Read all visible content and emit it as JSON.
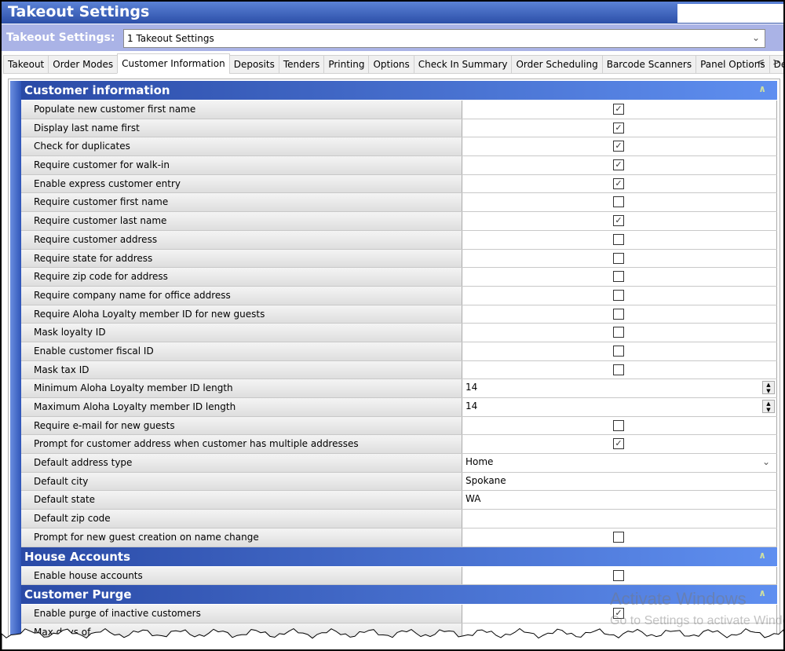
{
  "window": {
    "title": "Takeout Settings"
  },
  "selector": {
    "label": "Takeout Settings:",
    "value": "1 Takeout Settings"
  },
  "tabs": [
    "Takeout",
    "Order Modes",
    "Customer Information",
    "Deposits",
    "Tenders",
    "Printing",
    "Options",
    "Check In Summary",
    "Order Scheduling",
    "Barcode Scanners",
    "Panel Options",
    "Deliv"
  ],
  "active_tab": "Customer Information",
  "sections": [
    {
      "title": "Customer information",
      "rows": [
        {
          "label": "Populate new customer first name",
          "type": "checkbox",
          "checked": true
        },
        {
          "label": "Display last name first",
          "type": "checkbox",
          "checked": true
        },
        {
          "label": "Check for duplicates",
          "type": "checkbox",
          "checked": true
        },
        {
          "label": "Require customer for walk-in",
          "type": "checkbox",
          "checked": true
        },
        {
          "label": "Enable express customer entry",
          "type": "checkbox",
          "checked": true
        },
        {
          "label": "Require customer first name",
          "type": "checkbox",
          "checked": false
        },
        {
          "label": "Require customer last name",
          "type": "checkbox",
          "checked": true
        },
        {
          "label": "Require customer address",
          "type": "checkbox",
          "checked": false
        },
        {
          "label": "Require state for address",
          "type": "checkbox",
          "checked": false
        },
        {
          "label": "Require zip code for address",
          "type": "checkbox",
          "checked": false
        },
        {
          "label": "Require company name for office address",
          "type": "checkbox",
          "checked": false
        },
        {
          "label": "Require Aloha Loyalty member ID for new guests",
          "type": "checkbox",
          "checked": false
        },
        {
          "label": "Mask loyalty ID",
          "type": "checkbox",
          "checked": false
        },
        {
          "label": "Enable customer fiscal ID",
          "type": "checkbox",
          "checked": false
        },
        {
          "label": "Mask tax ID",
          "type": "checkbox",
          "checked": false
        },
        {
          "label": "Minimum Aloha Loyalty member ID length",
          "type": "spinner",
          "value": "14"
        },
        {
          "label": "Maximum Aloha Loyalty member ID length",
          "type": "spinner",
          "value": "14"
        },
        {
          "label": "Require e-mail for new guests",
          "type": "checkbox",
          "checked": false
        },
        {
          "label": "Prompt for customer address when customer has multiple addresses",
          "type": "checkbox",
          "checked": true
        },
        {
          "label": "Default address type",
          "type": "select",
          "value": "Home"
        },
        {
          "label": "Default city",
          "type": "text",
          "value": "Spokane"
        },
        {
          "label": "Default state",
          "type": "text",
          "value": "WA"
        },
        {
          "label": "Default zip code",
          "type": "text",
          "value": ""
        },
        {
          "label": "Prompt for new guest creation on name change",
          "type": "checkbox",
          "checked": false
        }
      ]
    },
    {
      "title": "House Accounts",
      "rows": [
        {
          "label": "Enable house accounts",
          "type": "checkbox",
          "checked": false
        }
      ]
    },
    {
      "title": "Customer Purge",
      "rows": [
        {
          "label": "Enable purge of inactive customers",
          "type": "checkbox",
          "checked": true
        },
        {
          "label": "Max days of",
          "type": "text",
          "value": ""
        }
      ]
    }
  ],
  "watermark": {
    "line1": "Activate Windows",
    "line2": "Go to Settings to activate Windows."
  }
}
